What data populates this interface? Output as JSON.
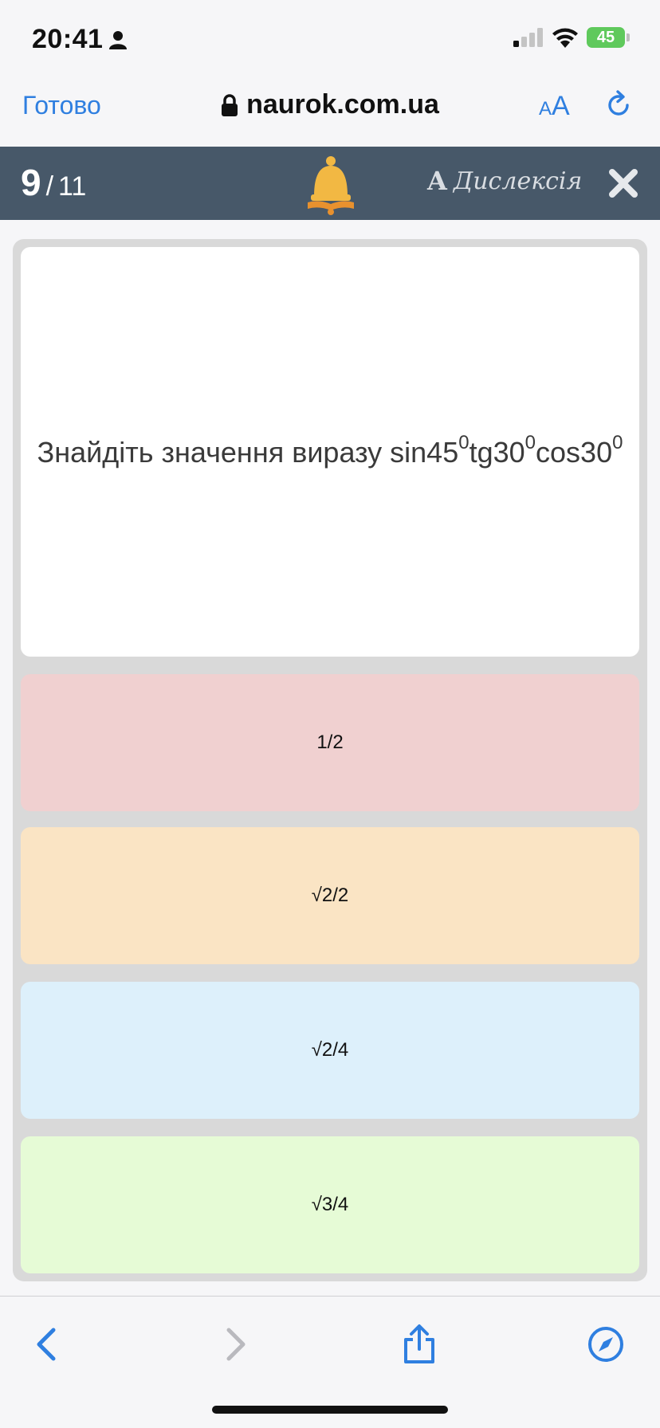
{
  "status_bar": {
    "time": "20:41",
    "battery_level": "45",
    "battery_color": "#5fc95c"
  },
  "browser": {
    "done_label": "Готово",
    "address": "naurok.com.ua",
    "text_size_small": "A",
    "text_size_large": "A",
    "accent_color": "#2f7fe0"
  },
  "quiz_header": {
    "current": "9",
    "separator": "/",
    "total": "11",
    "dyslexia_icon_letter": "A",
    "dyslexia_label": "Дислексія",
    "background_color": "#475869"
  },
  "question": {
    "prefix": "Знайдіть значення виразу sin45",
    "deg1": "0",
    "mid1": "tg30",
    "deg2": "0",
    "mid2": "cos30",
    "deg3": "0"
  },
  "answers": [
    {
      "label": "1/2",
      "color": "#f0d0d0"
    },
    {
      "label": "√2/2",
      "color": "#fae4c4"
    },
    {
      "label": "√2/4",
      "color": "#ddf0fb"
    },
    {
      "label": "√3/4",
      "color": "#e6fbd6"
    }
  ],
  "icons": {
    "person": "person-icon",
    "signal": "signal-icon",
    "wifi": "wifi-icon",
    "battery": "battery-icon",
    "lock": "lock-icon",
    "reload": "reload-icon",
    "bell": "bell-book-icon",
    "close": "close-icon",
    "back": "chevron-left-icon",
    "forward": "chevron-right-icon",
    "share": "share-icon",
    "compass": "compass-icon"
  }
}
